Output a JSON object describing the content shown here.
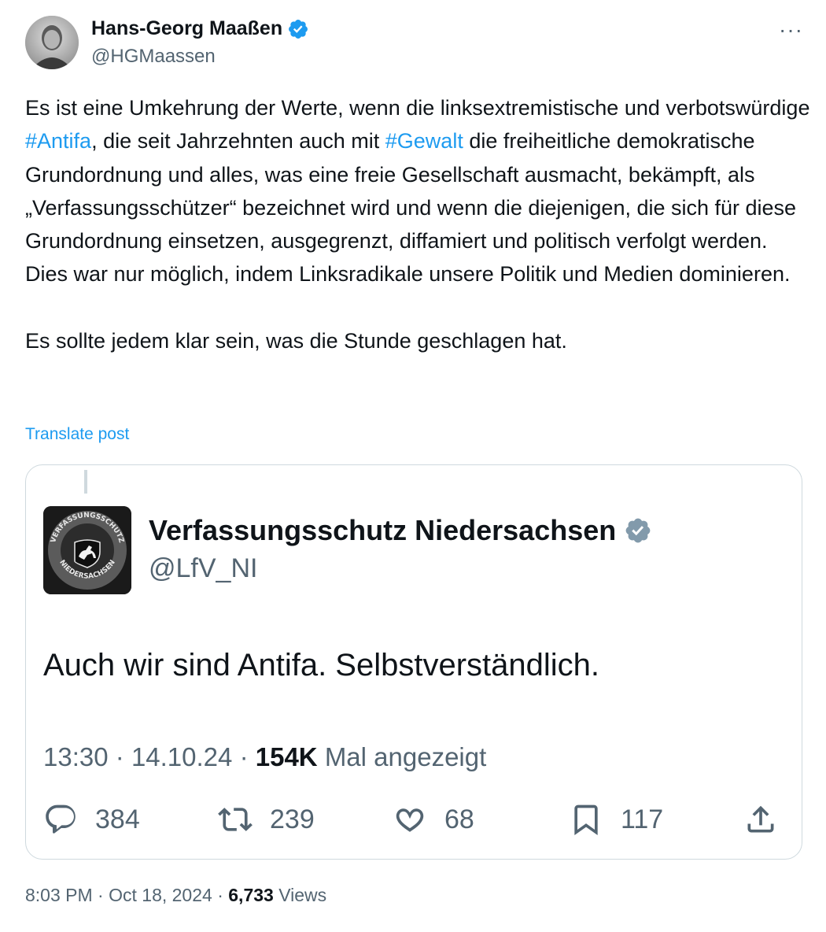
{
  "author": {
    "name": "Hans-Georg Maaßen",
    "handle": "@HGMaassen",
    "verified_color": "#1d9bf0",
    "avatar_icon": "portrait-photo"
  },
  "more_icon": "more-horizontal-icon",
  "more_label": "···",
  "post": {
    "p1": {
      "t1": "Es ist eine Umkehrung der Werte, wenn die linksextremistische und verbotswürdige ",
      "h1": "#Antifa",
      "t2": ", die seit Jahrzehnten auch mit ",
      "h2": "#Gewalt",
      "t3": " die freiheitliche demokratische Grundordnung und alles, was eine freie Gesellschaft ausmacht, bekämpft, als „Verfassungsschützer“ bezeichnet wird und wenn die diejenigen, die sich für diese Grundordnung einsetzen, ausgegrenzt, diffamiert und politisch verfolgt werden. Dies war nur möglich, indem Linksradikale unsere Politik und Medien dominieren."
    },
    "p2": "Es sollte jedem klar sein, was die Stunde geschlagen hat.",
    "translate_label": "Translate post"
  },
  "quote": {
    "name": "Verfassungsschutz Niedersachsen",
    "handle": "@LfV_NI",
    "verified_color": "#829aab",
    "logo_text": "VERFASSUNGSSCHUTZ NIEDERSACHSEN",
    "text": "Auch wir sind Antifa. Selbstverständlich.",
    "time": "13:30",
    "date": "14.10.24",
    "views_count": "154K",
    "views_label": "Mal angezeigt",
    "sep": "·",
    "actions": {
      "replies": "384",
      "reposts": "239",
      "likes": "68",
      "bookmarks": "117"
    }
  },
  "footer": {
    "time": "8:03 PM",
    "date": "Oct 18, 2024",
    "views_count": "6,733",
    "views_label": "Views",
    "sep": "·"
  }
}
